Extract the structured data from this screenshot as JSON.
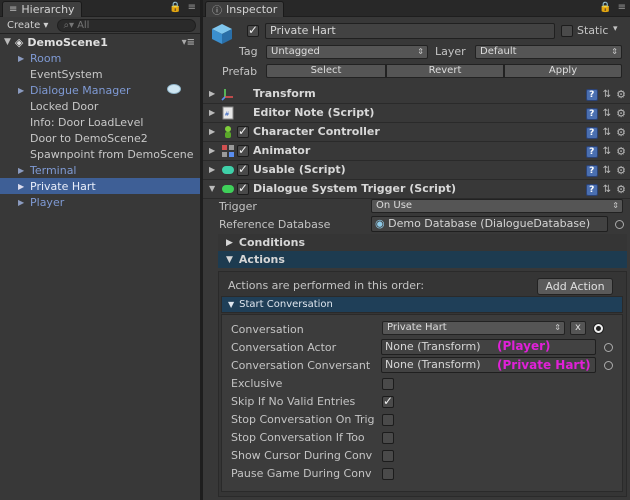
{
  "hierarchy": {
    "tab_title": "Hierarchy",
    "create_label": "Create ▾",
    "search_placeholder": "All",
    "scene_name": "DemoScene1",
    "items": [
      {
        "label": "Room",
        "prefab": true,
        "expandable": true
      },
      {
        "label": "EventSystem",
        "prefab": false,
        "expandable": false
      },
      {
        "label": "Dialogue Manager",
        "prefab": true,
        "expandable": true
      },
      {
        "label": "Locked Door",
        "prefab": false,
        "expandable": false
      },
      {
        "label": "Info: Door LoadLevel",
        "prefab": false,
        "expandable": false
      },
      {
        "label": "Door to DemoScene2",
        "prefab": false,
        "expandable": false
      },
      {
        "label": "Spawnpoint from DemoScene",
        "prefab": false,
        "expandable": false
      },
      {
        "label": "Terminal",
        "prefab": true,
        "expandable": true
      },
      {
        "label": "Private Hart",
        "prefab": true,
        "expandable": true,
        "selected": true
      },
      {
        "label": "Player",
        "prefab": true,
        "expandable": true
      }
    ]
  },
  "inspector": {
    "tab_title": "Inspector",
    "object_name": "Private Hart",
    "static_label": "Static",
    "tag_label": "Tag",
    "tag_value": "Untagged",
    "layer_label": "Layer",
    "layer_value": "Default",
    "prefab_label": "Prefab",
    "prefab_select": "Select",
    "prefab_revert": "Revert",
    "prefab_apply": "Apply",
    "components": [
      {
        "title": "Transform",
        "icon": "transform-icon",
        "checkbox": false
      },
      {
        "title": "Editor Note (Script)",
        "icon": "script-icon",
        "checkbox": false
      },
      {
        "title": "Character Controller",
        "icon": "character-controller-icon",
        "checkbox": true
      },
      {
        "title": "Animator",
        "icon": "animator-icon",
        "checkbox": true
      },
      {
        "title": "Usable (Script)",
        "icon": "usable-icon",
        "checkbox": true
      },
      {
        "title": "Dialogue System Trigger (Script)",
        "icon": "dialogue-trigger-icon",
        "checkbox": true
      }
    ],
    "trigger_label": "Trigger",
    "trigger_value": "On Use",
    "refdb_label": "Reference Database",
    "refdb_value": "Demo Database (DialogueDatabase)",
    "conditions_label": "Conditions",
    "actions_label": "Actions",
    "actions_note": "Actions are performed in this order:",
    "add_action_label": "Add Action",
    "start_conversation_label": "Start Conversation",
    "fields": {
      "conversation_label": "Conversation",
      "conversation_value": "Private Hart",
      "clear_label": "x",
      "actor_label": "Conversation Actor",
      "actor_value": "None (Transform)",
      "actor_annotation": "(Player)",
      "conversant_label": "Conversation Conversant",
      "conversant_value": "None (Transform)",
      "conversant_annotation": "(Private Hart)",
      "exclusive_label": "Exclusive",
      "skip_label": "Skip If No Valid Entries",
      "stop_trig_label": "Stop Conversation On Trig",
      "stop_too_label": "Stop Conversation If Too",
      "show_cursor_label": "Show Cursor During Conv",
      "pause_label": "Pause Game During Conv"
    },
    "checkbox_states": {
      "exclusive": false,
      "skip": true,
      "stop_trig": false,
      "stop_too": false,
      "show_cursor": false,
      "pause": false
    }
  },
  "colors": {
    "selection": "#3e5f96",
    "prefab_text": "#7f9ad4",
    "annotation": "#e020d8",
    "actions_header": "#1d3b50"
  }
}
